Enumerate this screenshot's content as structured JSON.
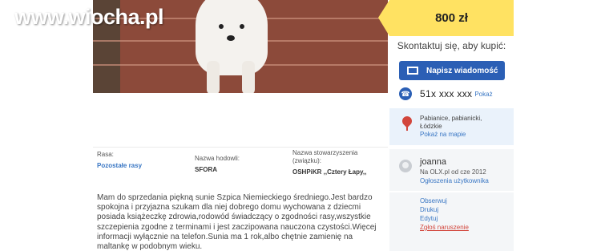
{
  "watermark": "www.wiocha.pl",
  "listing": {
    "price": "800 zł",
    "contact_label": "Skontaktuj się, aby kupić:",
    "message_button": "Napisz wiadomość",
    "phone_number": "51x xxx xxx",
    "phone_show": "Pokaż",
    "location": {
      "line1": "Pabianice, pabianicki,",
      "line2": "Łódzkie",
      "map_link": "Pokaż na mapie"
    }
  },
  "attributes": [
    {
      "label": "Rasa:",
      "value": "Pozostałe rasy"
    },
    {
      "label": "Nazwa hodowli:",
      "value": "SFORA"
    },
    {
      "label_line1": "Nazwa stowarzyszenia",
      "label_line2": "(związku):",
      "value": "OSHPiKR ,,Cztery Łapy,,"
    }
  ],
  "description": "Mam do sprzedania piękną sunie Szpica Niemieckiego średniego.Jest bardzo spokojna i przyjazna szukam dla niej dobrego domu wychowana z dziecmi posiada książeczkę zdrowia,rodowód świadczący o zgodności rasy,wszystkie szczepienia zgodne z terminami i jest zaczipowana nauczona czystości.Więcej informacji wyłącznie na telefon.Sunia ma 1 rok,albo chętnie zamienię na maltankę w podobnym wieku.",
  "user": {
    "name": "joanna",
    "since": "Na OLX.pl od cze 2012",
    "ads_link": "Ogłoszenia użytkownika"
  },
  "actions": {
    "observe": "Obserwuj",
    "print": "Drukuj",
    "edit": "Edytuj",
    "report": "Zgłoś naruszenie"
  },
  "colors": {
    "price_bg": "#ffe262",
    "button_blue": "#2b5fb5",
    "link_blue": "#3a77c4",
    "pin_red": "#d2463c",
    "location_bg": "#eaf2fb"
  },
  "icons": [
    "envelope-icon",
    "phone-icon",
    "map-pin-icon",
    "avatar-icon"
  ]
}
